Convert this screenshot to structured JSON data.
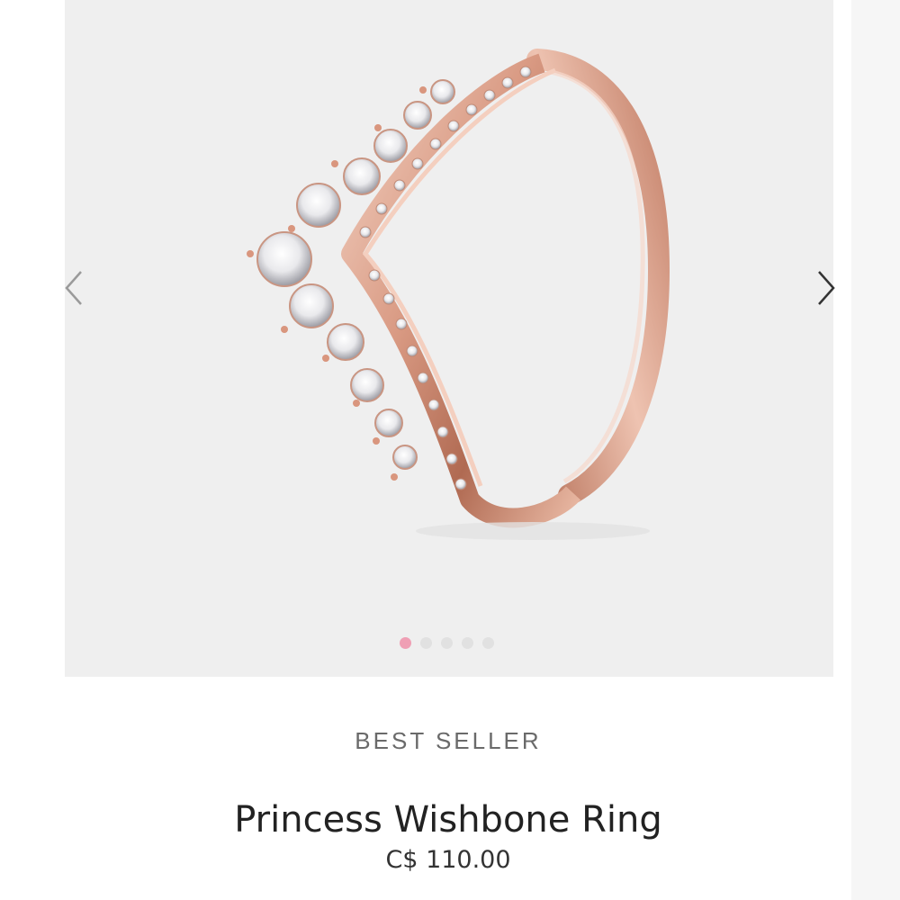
{
  "gallery": {
    "image_alt": "Princess Wishbone Ring",
    "total_images": 5,
    "active_index": 0,
    "prev_icon": "chevron-left-icon",
    "next_icon": "chevron-right-icon",
    "dot_active_color": "#ef9fb4",
    "dot_inactive_color": "#e1e1e1"
  },
  "product": {
    "badge": "BEST SELLER",
    "name": "Princess Wishbone Ring",
    "price": "C$ 110.00"
  },
  "colors": {
    "gallery_bg": "#efefef",
    "metal": "#d79a83"
  }
}
